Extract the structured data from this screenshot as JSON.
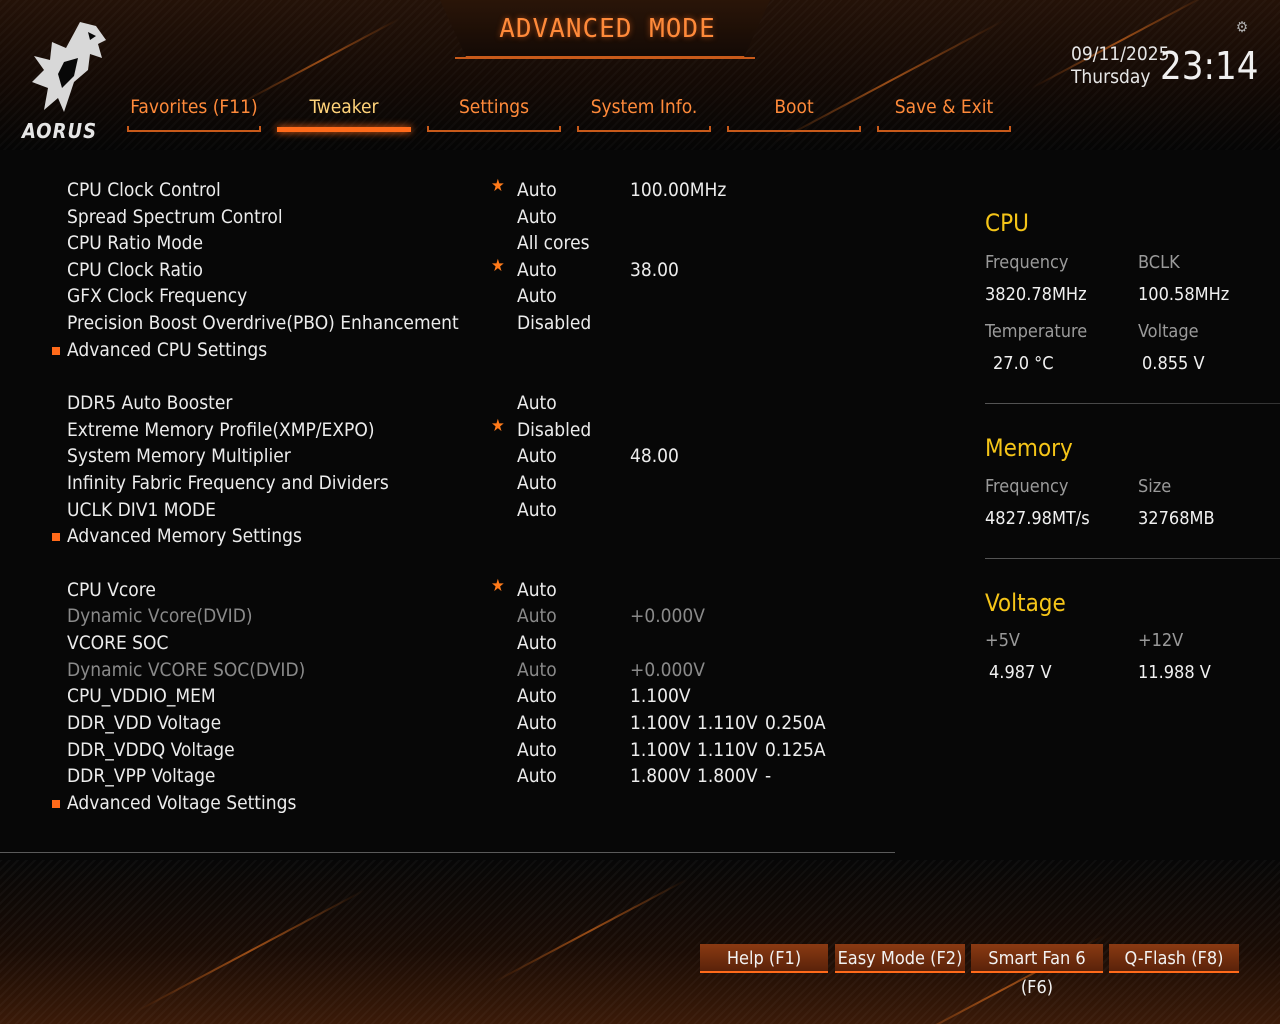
{
  "header": {
    "title": "ADVANCED MODE",
    "logo_text": "AORUS",
    "date": "09/11/2025",
    "day": "Thursday",
    "time": "23:14"
  },
  "tabs": [
    {
      "label": "Favorites (F11)"
    },
    {
      "label": "Tweaker"
    },
    {
      "label": "Settings"
    },
    {
      "label": "System Info."
    },
    {
      "label": "Boot"
    },
    {
      "label": "Save & Exit"
    }
  ],
  "settings": [
    {
      "label": "CPU Clock Control",
      "value": "Auto",
      "extra1": "100.00MHz"
    },
    {
      "label": "Spread Spectrum Control",
      "value": "Auto"
    },
    {
      "label": "CPU Ratio Mode",
      "value": "All cores"
    },
    {
      "label": "CPU Clock Ratio",
      "value": "Auto",
      "extra1": "38.00"
    },
    {
      "label": "GFX Clock Frequency",
      "value": "Auto"
    },
    {
      "label": "Precision Boost Overdrive(PBO) Enhancement",
      "value": "Disabled"
    },
    {
      "label": "Advanced CPU Settings"
    },
    {
      "label": "DDR5 Auto Booster",
      "value": "Auto"
    },
    {
      "label": "Extreme Memory Profile(XMP/EXPO)",
      "value": "Disabled"
    },
    {
      "label": "System Memory Multiplier",
      "value": "Auto",
      "extra1": "48.00"
    },
    {
      "label": "Infinity Fabric Frequency and Dividers",
      "value": "Auto"
    },
    {
      "label": "UCLK DIV1 MODE",
      "value": "Auto"
    },
    {
      "label": "Advanced Memory Settings"
    },
    {
      "label": "CPU Vcore",
      "value": "Auto"
    },
    {
      "label": "Dynamic Vcore(DVID)",
      "value": "Auto",
      "extra1": "+0.000V"
    },
    {
      "label": "VCORE SOC",
      "value": "Auto"
    },
    {
      "label": "Dynamic VCORE SOC(DVID)",
      "value": "Auto",
      "extra1": "+0.000V"
    },
    {
      "label": "CPU_VDDIO_MEM",
      "value": "Auto",
      "extra1": "1.100V"
    },
    {
      "label": "DDR_VDD Voltage",
      "value": "Auto",
      "extra1": "1.100V",
      "extra2": "1.110V",
      "extra3": "0.250A"
    },
    {
      "label": "DDR_VDDQ Voltage",
      "value": "Auto",
      "extra1": "1.100V",
      "extra2": "1.110V",
      "extra3": "0.125A"
    },
    {
      "label": "DDR_VPP Voltage",
      "value": "Auto",
      "extra1": "1.800V",
      "extra2": "1.800V",
      "extra3": "-"
    },
    {
      "label": "Advanced Voltage Settings"
    }
  ],
  "panel": {
    "cpu": {
      "title": "CPU",
      "frequency_label": "Frequency",
      "frequency": "3820.78MHz",
      "bclk_label": "BCLK",
      "bclk": "100.58MHz",
      "temperature_label": "Temperature",
      "temperature": "27.0 °C",
      "voltage_label": "Voltage",
      "voltage": "0.855 V"
    },
    "memory": {
      "title": "Memory",
      "frequency_label": "Frequency",
      "frequency": "4827.98MT/s",
      "size_label": "Size",
      "size": "32768MB"
    },
    "voltage": {
      "title": "Voltage",
      "v5_label": "+5V",
      "v5": "4.987 V",
      "v12_label": "+12V",
      "v12": "11.988 V"
    }
  },
  "buttons": {
    "help": "Help (F1)",
    "easy_mode": "Easy Mode (F2)",
    "smart_fan": "Smart Fan 6 (F6)",
    "qflash": "Q-Flash (F8)"
  },
  "colors": {
    "accent": "#ff6a1a",
    "tab_text": "#ff8a3a",
    "panel_title": "#f5c518",
    "star": "#ff7a1a"
  }
}
